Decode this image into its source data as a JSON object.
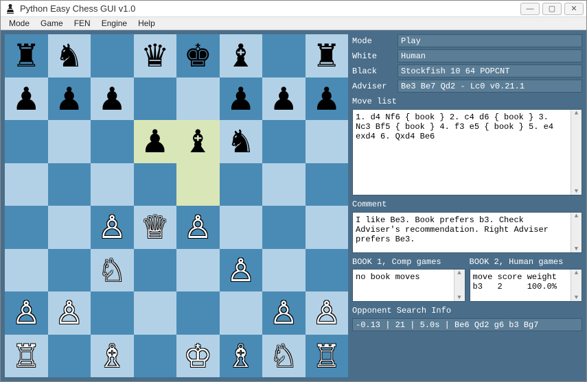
{
  "window": {
    "title": "Python Easy Chess GUI v1.0"
  },
  "menu": [
    "Mode",
    "Game",
    "FEN",
    "Engine",
    "Help"
  ],
  "form": {
    "mode_label": "Mode",
    "mode_value": "Play",
    "white_label": "White",
    "white_value": "Human",
    "black_label": "Black",
    "black_value": "Stockfish 10 64 POPCNT",
    "adviser_label": "Adviser",
    "adviser_value": "Be3 Be7 Qd2 - Lc0 v0.21.1"
  },
  "movelist": {
    "label": "Move list",
    "text": "1. d4 Nf6 { book } 2. c4 d6 { book } 3. Nc3 Bf5 { book } 4. f3 e5 { book } 5. e4 exd4 6. Qxd4 Be6"
  },
  "comment": {
    "label": "Comment",
    "text": "I like Be3. Book prefers b3. Check Adviser's recommendation. Right Adviser prefers Be3."
  },
  "book1": {
    "label": "BOOK 1, Comp games",
    "text": "no book moves"
  },
  "book2": {
    "label": "BOOK 2, Human games",
    "text": "move score weight\nb3   2     100.0%"
  },
  "opp": {
    "label": "Opponent Search Info",
    "text": "-0.13 | 21 | 5.0s | Be6 Qd2 g6 b3 Bg7"
  },
  "board": {
    "highlight": [
      "d6",
      "e6",
      "e5"
    ],
    "pieces": {
      "a8": "br",
      "b8": "bn",
      "d8": "bq",
      "e8": "bk",
      "f8": "bb",
      "h8": "br",
      "a7": "bp",
      "b7": "bp",
      "c7": "bp",
      "f7": "bp",
      "g7": "bp",
      "h7": "bp",
      "d6": "bp",
      "e6": "bb",
      "f6": "bn",
      "c4": "wp",
      "d4": "wq",
      "e4": "wp",
      "c3": "wn",
      "f3": "wp",
      "a2": "wp",
      "b2": "wp",
      "g2": "wp",
      "h2": "wp",
      "a1": "wr",
      "c1": "wb",
      "e1": "wk",
      "f1": "wb",
      "g1": "wn",
      "h1": "wr"
    }
  }
}
